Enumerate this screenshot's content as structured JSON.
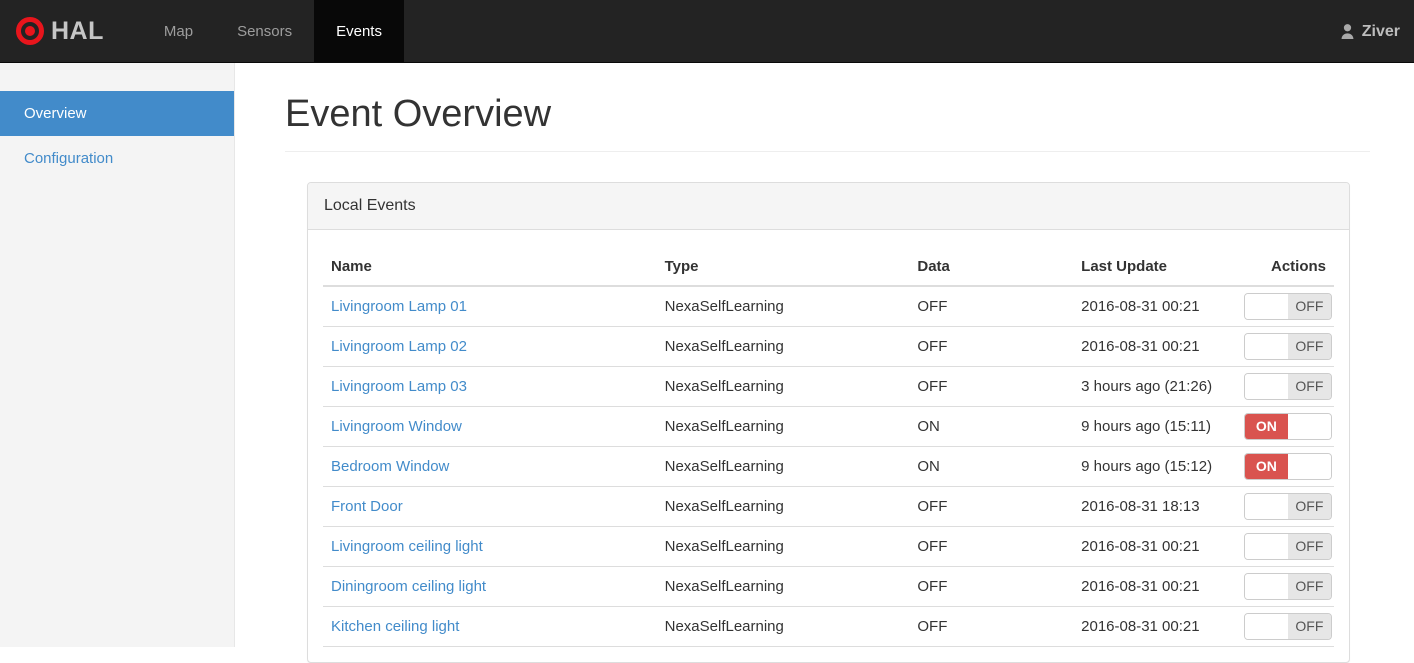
{
  "colors": {
    "accent_blue": "#428bca",
    "toggle_on_red": "#d9534f",
    "navbar_bg": "#232323",
    "active_tab_bg": "#080808",
    "brand_red": "#e8151c"
  },
  "navbar": {
    "brand": "HAL",
    "brand_icon": "bullseye-icon",
    "items": [
      {
        "label": "Map",
        "active": false
      },
      {
        "label": "Sensors",
        "active": false
      },
      {
        "label": "Events",
        "active": true
      }
    ],
    "user": {
      "label": "Ziver",
      "icon": "user-icon"
    }
  },
  "sidebar": {
    "items": [
      {
        "label": "Overview",
        "active": true
      },
      {
        "label": "Configuration",
        "active": false
      }
    ]
  },
  "main": {
    "title": "Event Overview",
    "panel": {
      "title": "Local Events",
      "table": {
        "headers": [
          "Name",
          "Type",
          "Data",
          "Last Update",
          "Actions"
        ],
        "rows": [
          {
            "name": "Livingroom Lamp 01",
            "type": "NexaSelfLearning",
            "data": "OFF",
            "last_update": "2016-08-31 00:21",
            "toggle": "OFF"
          },
          {
            "name": "Livingroom Lamp 02",
            "type": "NexaSelfLearning",
            "data": "OFF",
            "last_update": "2016-08-31 00:21",
            "toggle": "OFF"
          },
          {
            "name": "Livingroom Lamp 03",
            "type": "NexaSelfLearning",
            "data": "OFF",
            "last_update": "3 hours ago (21:26)",
            "toggle": "OFF"
          },
          {
            "name": "Livingroom Window",
            "type": "NexaSelfLearning",
            "data": "ON",
            "last_update": "9 hours ago (15:11)",
            "toggle": "ON"
          },
          {
            "name": "Bedroom Window",
            "type": "NexaSelfLearning",
            "data": "ON",
            "last_update": "9 hours ago (15:12)",
            "toggle": "ON"
          },
          {
            "name": "Front Door",
            "type": "NexaSelfLearning",
            "data": "OFF",
            "last_update": "2016-08-31 18:13",
            "toggle": "OFF"
          },
          {
            "name": "Livingroom ceiling light",
            "type": "NexaSelfLearning",
            "data": "OFF",
            "last_update": "2016-08-31 00:21",
            "toggle": "OFF"
          },
          {
            "name": "Diningroom ceiling light",
            "type": "NexaSelfLearning",
            "data": "OFF",
            "last_update": "2016-08-31 00:21",
            "toggle": "OFF"
          },
          {
            "name": "Kitchen ceiling light",
            "type": "NexaSelfLearning",
            "data": "OFF",
            "last_update": "2016-08-31 00:21",
            "toggle": "OFF"
          }
        ]
      }
    }
  }
}
